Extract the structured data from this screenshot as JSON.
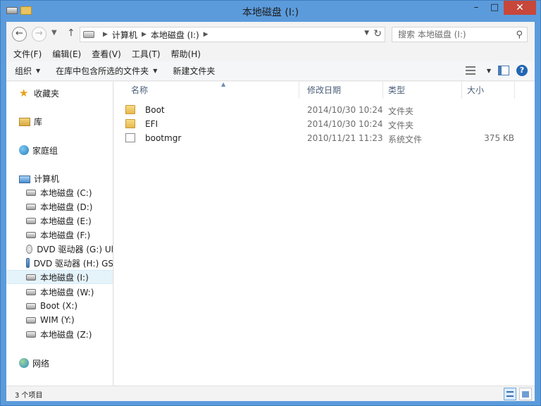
{
  "window": {
    "title": "本地磁盘 (I:)"
  },
  "address": {
    "crumbs": [
      "计算机",
      "本地磁盘 (I:)"
    ],
    "search_placeholder": "搜索 本地磁盘 (I:)"
  },
  "menu": [
    "文件(F)",
    "编辑(E)",
    "查看(V)",
    "工具(T)",
    "帮助(H)"
  ],
  "toolbar": {
    "organize": "组织",
    "include_library": "在库中包含所选的文件夹",
    "new_folder": "新建文件夹"
  },
  "nav": {
    "favorites": "收藏夹",
    "libraries": "库",
    "homegroup": "家庭组",
    "computer": "计算机",
    "drives": [
      "本地磁盘 (C:)",
      "本地磁盘 (D:)",
      "本地磁盘 (E:)",
      "本地磁盘 (F:)",
      "DVD 驱动器 (G:) Ul",
      "DVD 驱动器 (H:) GS",
      "本地磁盘 (I:)",
      "本地磁盘 (W:)",
      "Boot (X:)",
      "WIM (Y:)",
      "本地磁盘 (Z:)"
    ],
    "network": "网络"
  },
  "columns": {
    "name": "名称",
    "modified": "修改日期",
    "type": "类型",
    "size": "大小"
  },
  "files": [
    {
      "name": "Boot",
      "modified": "2014/10/30 10:24",
      "type": "文件夹",
      "size": ""
    },
    {
      "name": "EFI",
      "modified": "2014/10/30 10:24",
      "type": "文件夹",
      "size": ""
    },
    {
      "name": "bootmgr",
      "modified": "2010/11/21 11:23",
      "type": "系统文件",
      "size": "375 KB"
    }
  ],
  "status": {
    "count": "3 个项目"
  }
}
